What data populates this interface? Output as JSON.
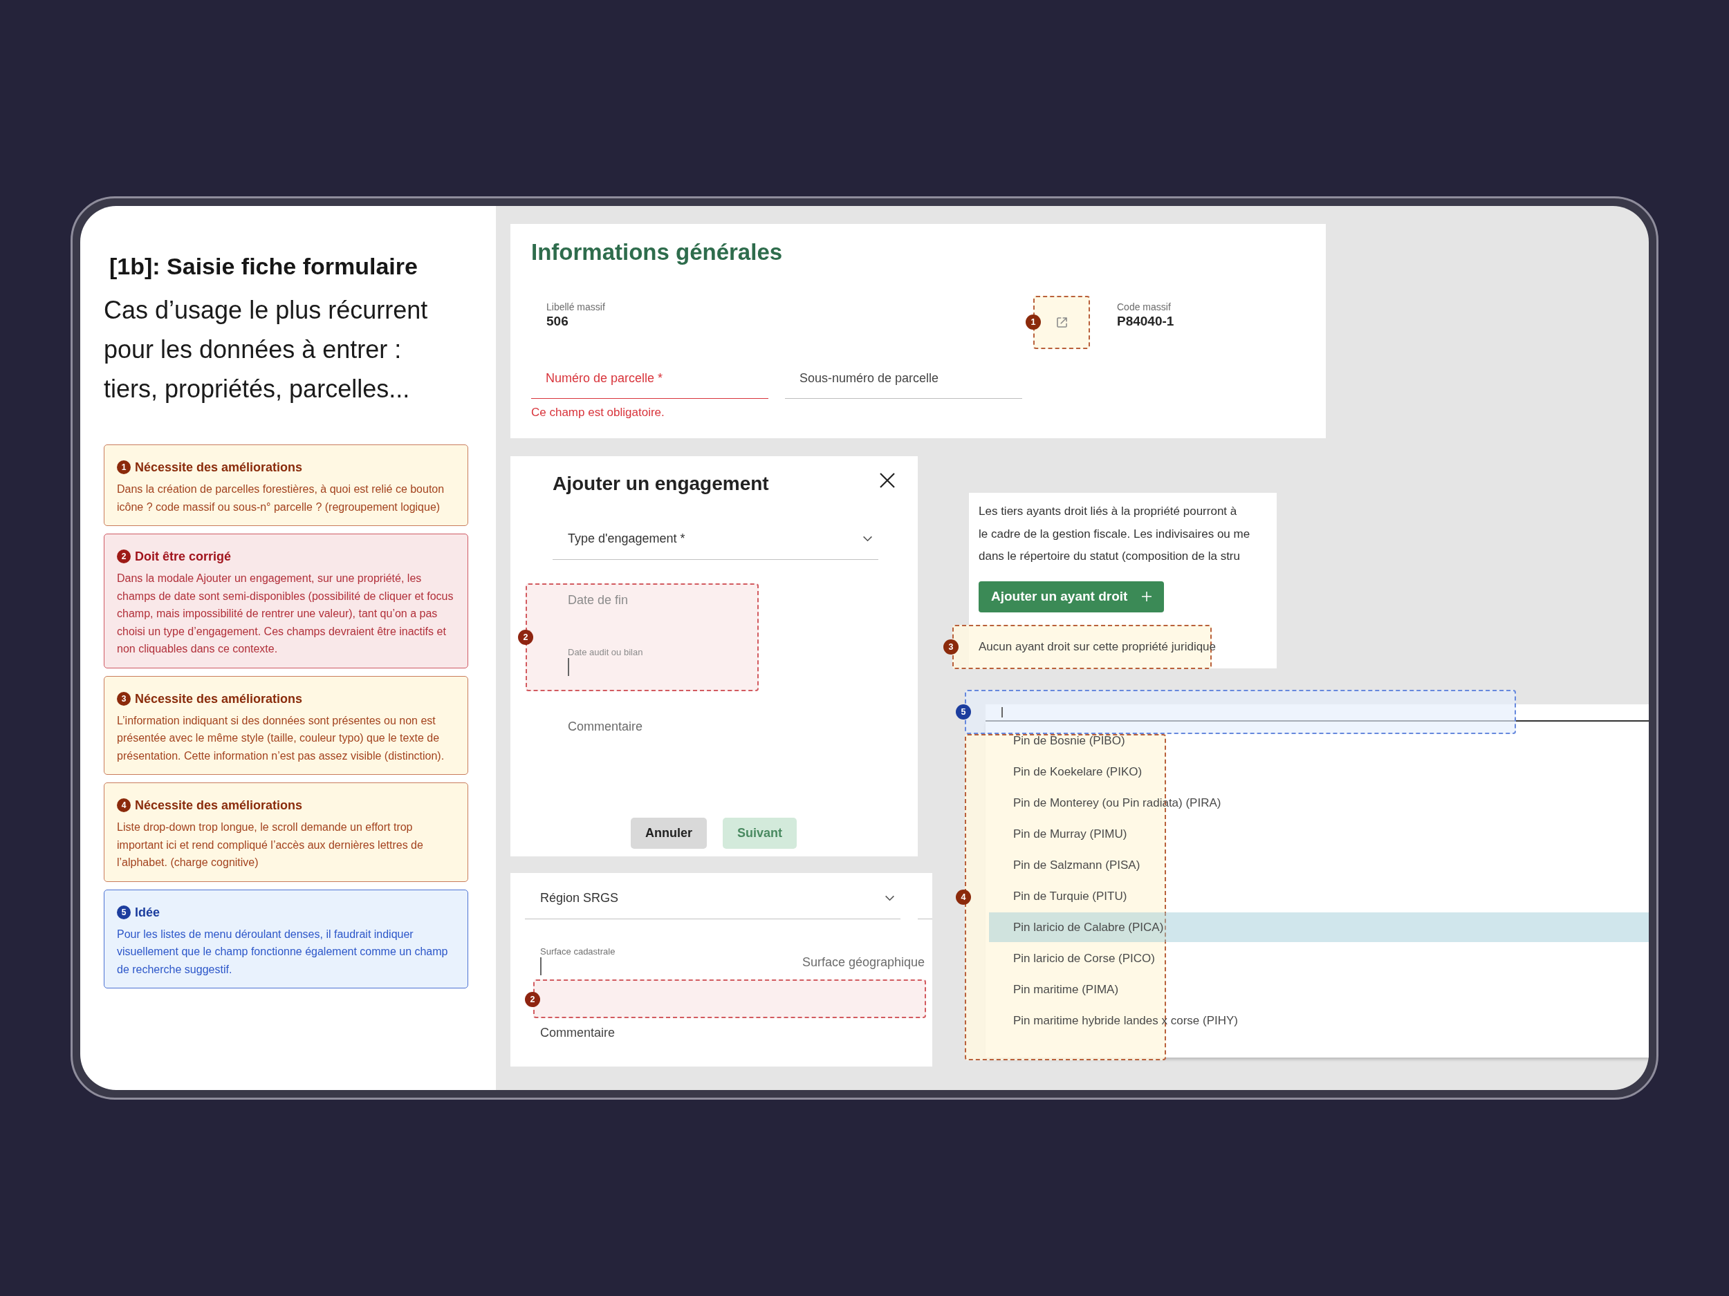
{
  "intro": {
    "title": "[1b]: Saisie fiche formulaire",
    "subtitle": "Cas d’usage le plus récurrent pour les données à entrer : tiers, propriétés, parcelles..."
  },
  "issues": [
    {
      "number": "1",
      "kind": "improve",
      "title": "Nécessite des améliorations",
      "text": "Dans la création de parcelles forestières, à quoi est relié ce bouton icône ? code massif ou sous-n° parcelle ? (regroupement logique)"
    },
    {
      "number": "2",
      "kind": "fix",
      "title": "Doit être corrigé",
      "text": "Dans la modale Ajouter un engagement, sur une propriété, les champs de date sont semi-disponibles (possibilité de cliquer et focus champ, mais impossibilité de rentrer une valeur), tant qu’on a pas choisi un type d’engagement. Ces champs devraient être inactifs et non cliquables dans ce contexte."
    },
    {
      "number": "3",
      "kind": "improve",
      "title": "Nécessite des améliorations",
      "text": "L’information indiquant si des données sont présentes ou non est présentée avec le même style (taille, couleur typo) que le texte de présentation. Cette information n’est pas assez visible (distinction)."
    },
    {
      "number": "4",
      "kind": "improve",
      "title": "Nécessite des améliorations",
      "text": "Liste drop-down trop longue, le scroll demande un effort trop important ici et rend compliqué l’accès aux dernières lettres de l’alphabet. (charge cognitive)"
    },
    {
      "number": "5",
      "kind": "idea",
      "title": "Idée",
      "text": "Pour les listes de menu déroulant denses, il faudrait indiquer visuellement que le champ fonctionne également comme un champ de recherche suggestif."
    }
  ],
  "general_info": {
    "title": "Informations générales",
    "fields": [
      {
        "label": "Libellé massif",
        "value": "506"
      },
      {
        "label": "Code massif",
        "value": "P84040-1"
      }
    ],
    "inputs": [
      {
        "label": "Numéro de parcelle *",
        "error": true
      },
      {
        "label": "Sous-numéro de parcelle",
        "error": false
      }
    ],
    "error_message": "Ce champ est obligatoire.",
    "annotation": {
      "number": "1",
      "kind": "improve"
    }
  },
  "engagement_modal": {
    "title": "Ajouter un engagement",
    "fields": [
      {
        "kind": "select",
        "label": "Type d'engagement *",
        "focused": false,
        "disabled": false
      },
      {
        "kind": "text",
        "label": "Date de fin",
        "focused": false,
        "disabled": true
      },
      {
        "kind": "text",
        "label": "Date audit ou bilan",
        "focused": true,
        "disabled": true
      },
      {
        "kind": "text",
        "label": "Commentaire",
        "focused": false,
        "disabled": false
      }
    ],
    "buttons": [
      {
        "kind": "secondary",
        "label": "Annuler",
        "disabled": false
      },
      {
        "kind": "primary",
        "label": "Suivant",
        "disabled": true
      }
    ],
    "annotation": {
      "number": "2",
      "kind": "fix"
    }
  },
  "owners": {
    "lines": [
      "Les tiers ayants droit liés à la propriété pourront à",
      "le cadre de la gestion fiscale. Les indivisaires ou me",
      "dans le répertoire du statut (composition de la stru"
    ],
    "add_button": "Ajouter un ayant droit",
    "empty_message": "Aucun ayant droit sur cette propriété juridique",
    "annotation": {
      "number": "3",
      "kind": "improve"
    }
  },
  "species_select": {
    "focused": true,
    "search_annotation": {
      "number": "5",
      "kind": "idea"
    },
    "options": [
      {
        "label": "Pin de Bosnie (PIBO)",
        "selected": false
      },
      {
        "label": "Pin de Koekelare (PIKO)",
        "selected": false
      },
      {
        "label": "Pin de Monterey (ou Pin radiata) (PIRA)",
        "selected": false
      },
      {
        "label": "Pin de Murray (PIMU)",
        "selected": false
      },
      {
        "label": "Pin de Salzmann (PISA)",
        "selected": false
      },
      {
        "label": "Pin de Turquie (PITU)",
        "selected": false
      },
      {
        "label": "Pin laricio de Calabre (PICA)",
        "selected": true
      },
      {
        "label": "Pin laricio de Corse (PICO)",
        "selected": false
      },
      {
        "label": "Pin maritime (PIMA)",
        "selected": false
      },
      {
        "label": "Pin maritime hybride landes x corse (PIHY)",
        "selected": false
      }
    ],
    "list_annotation": {
      "number": "4",
      "kind": "improve"
    }
  },
  "region_form": {
    "fields": [
      {
        "kind": "select",
        "label": "Région SRGS",
        "focused": false
      },
      {
        "kind": "text",
        "label": "Surface cadastrale",
        "focused": true
      },
      {
        "kind": "text",
        "label": "Surface géographique",
        "focused": false
      },
      {
        "kind": "text",
        "label": "Commentaire",
        "focused": false
      }
    ],
    "annotation": {
      "number": "2",
      "kind": "fix"
    }
  }
}
